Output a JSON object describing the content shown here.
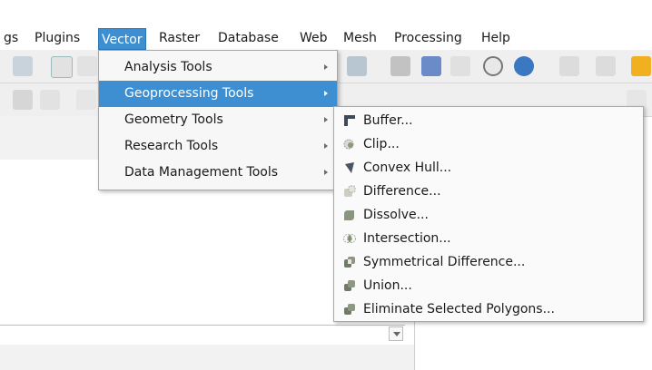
{
  "menubar": {
    "items": [
      {
        "label": "gs"
      },
      {
        "label": "Plugins"
      },
      {
        "label": "Vector"
      },
      {
        "label": "Raster"
      },
      {
        "label": "Database"
      },
      {
        "label": "Web"
      },
      {
        "label": "Mesh"
      },
      {
        "label": "Processing"
      },
      {
        "label": "Help"
      }
    ],
    "active": "Vector"
  },
  "vector_menu": {
    "items": [
      {
        "label": "Analysis Tools",
        "has_submenu": true
      },
      {
        "label": "Geoprocessing Tools",
        "has_submenu": true,
        "highlighted": true
      },
      {
        "label": "Geometry Tools",
        "has_submenu": true
      },
      {
        "label": "Research Tools",
        "has_submenu": true
      },
      {
        "label": "Data Management Tools",
        "has_submenu": true
      }
    ]
  },
  "geoprocessing_submenu": {
    "items": [
      {
        "label": "Buffer...",
        "icon": "buffer-icon"
      },
      {
        "label": "Clip...",
        "icon": "clip-icon"
      },
      {
        "label": "Convex Hull...",
        "icon": "convex-hull-icon"
      },
      {
        "label": "Difference...",
        "icon": "difference-icon"
      },
      {
        "label": "Dissolve...",
        "icon": "dissolve-icon"
      },
      {
        "label": "Intersection...",
        "icon": "intersection-icon"
      },
      {
        "label": "Symmetrical Difference...",
        "icon": "symmetrical-difference-icon"
      },
      {
        "label": "Union...",
        "icon": "union-icon"
      },
      {
        "label": "Eliminate Selected Polygons...",
        "icon": "eliminate-polygons-icon"
      }
    ]
  },
  "colors": {
    "highlight": "#3d8fd1",
    "menu_bg": "#f7f7f7",
    "toolbar_bg": "#efefef"
  }
}
